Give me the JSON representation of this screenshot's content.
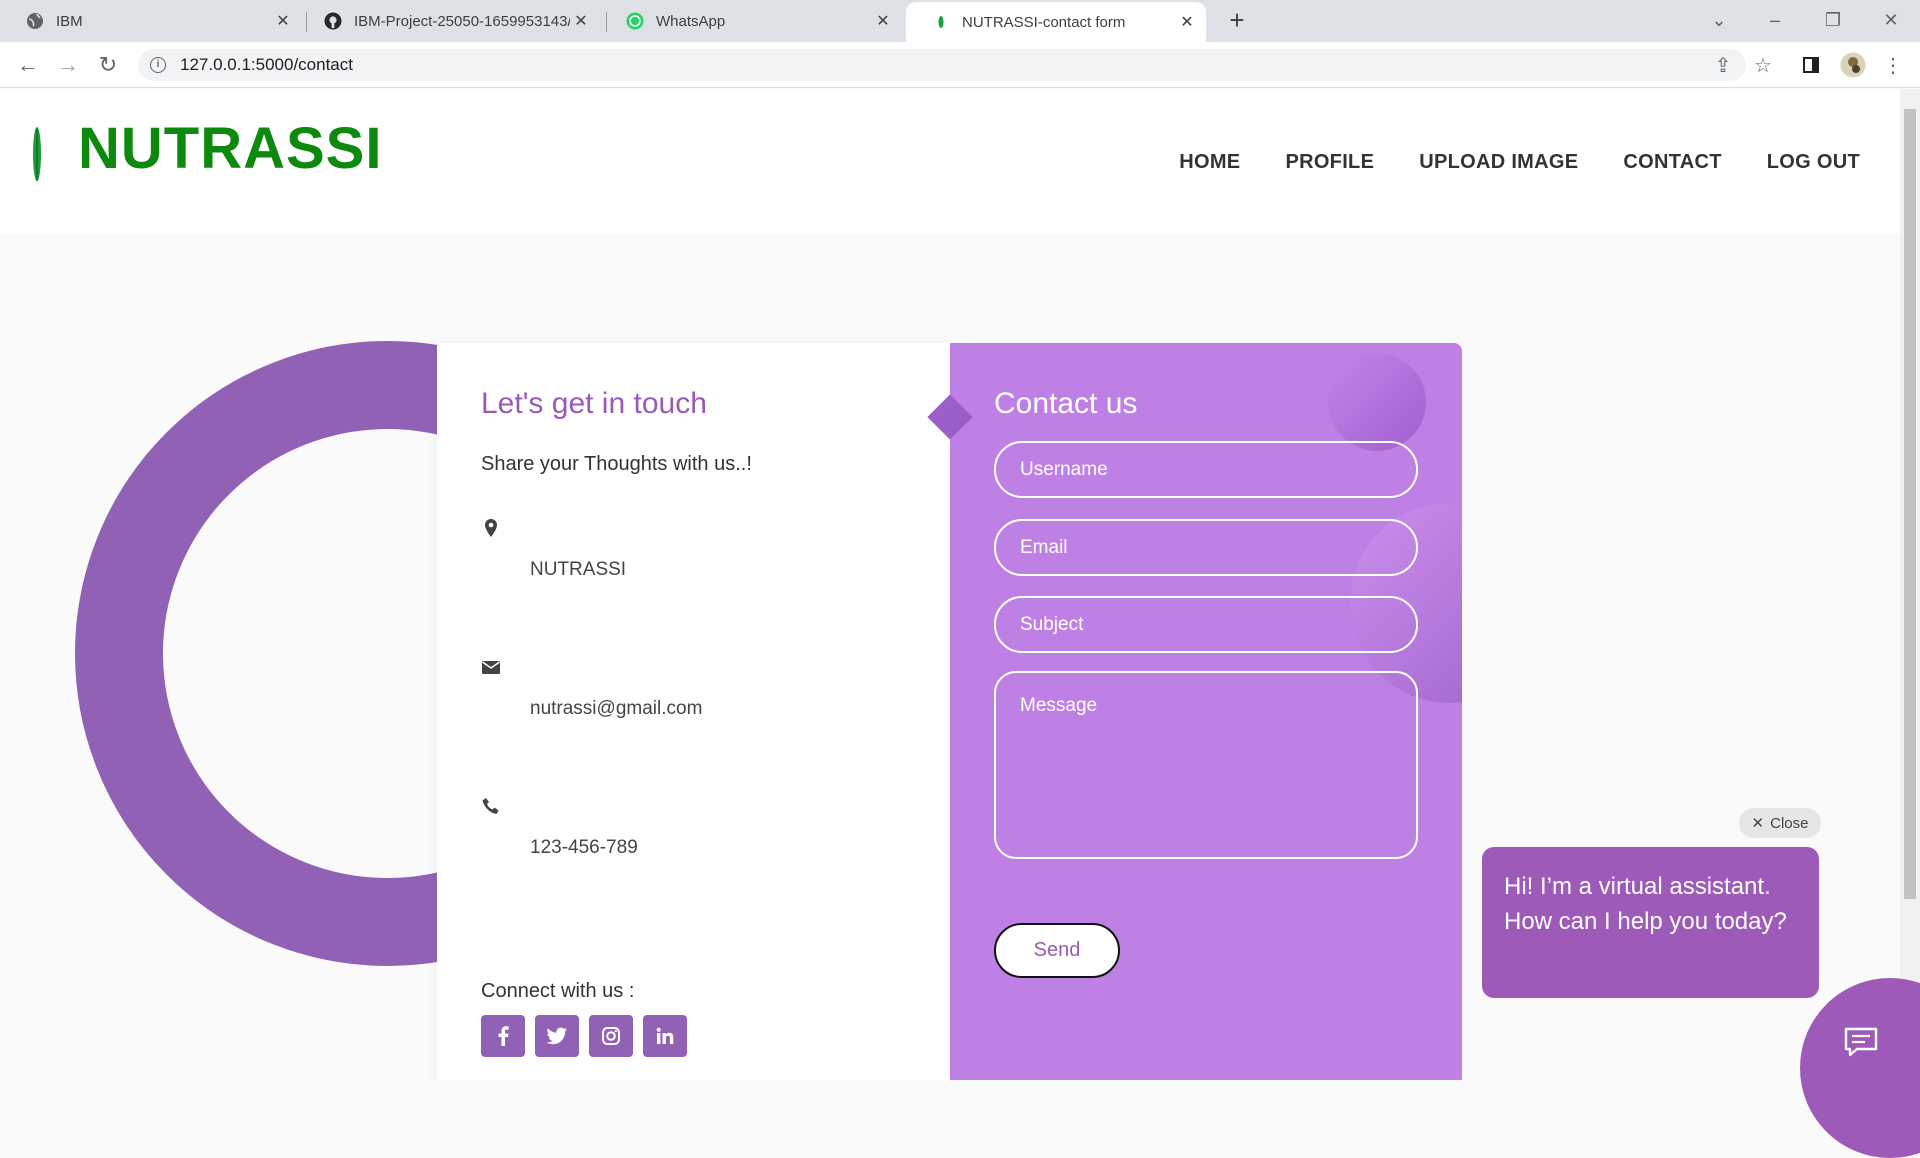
{
  "browser": {
    "tabs": [
      {
        "label": "IBM",
        "icon": "globe-icon"
      },
      {
        "label": "IBM-Project-25050-1659953143/",
        "icon": "github-icon"
      },
      {
        "label": "WhatsApp",
        "icon": "whatsapp-icon"
      },
      {
        "label": "NUTRASSI-contact form",
        "icon": "leaf-icon"
      }
    ],
    "url": "127.0.0.1:5000/contact"
  },
  "site": {
    "brand": "NUTRASSI",
    "nav": [
      "HOME",
      "PROFILE",
      "UPLOAD IMAGE",
      "CONTACT",
      "LOG OUT"
    ]
  },
  "contact_info": {
    "title": "Let's get in touch",
    "subtitle": "Share your Thoughts with us..!",
    "address": "NUTRASSI",
    "email": "nutrassi@gmail.com",
    "phone": "123-456-789",
    "connect_label": "Connect with us :",
    "social": [
      "facebook-icon",
      "twitter-icon",
      "instagram-icon",
      "linkedin-icon"
    ]
  },
  "form": {
    "title": "Contact us",
    "username_placeholder": "Username",
    "email_placeholder": "Email",
    "subject_placeholder": "Subject",
    "message_placeholder": "Message",
    "send_label": "Send"
  },
  "assistant": {
    "close_label": "Close",
    "message": "Hi! I’m a virtual assistant. How can I help you today?"
  },
  "colors": {
    "brand_green": "#0d8a0d",
    "purple": "#9161b6",
    "form_bg": "#bf80e6",
    "chat_purple": "#9d5ab8"
  }
}
